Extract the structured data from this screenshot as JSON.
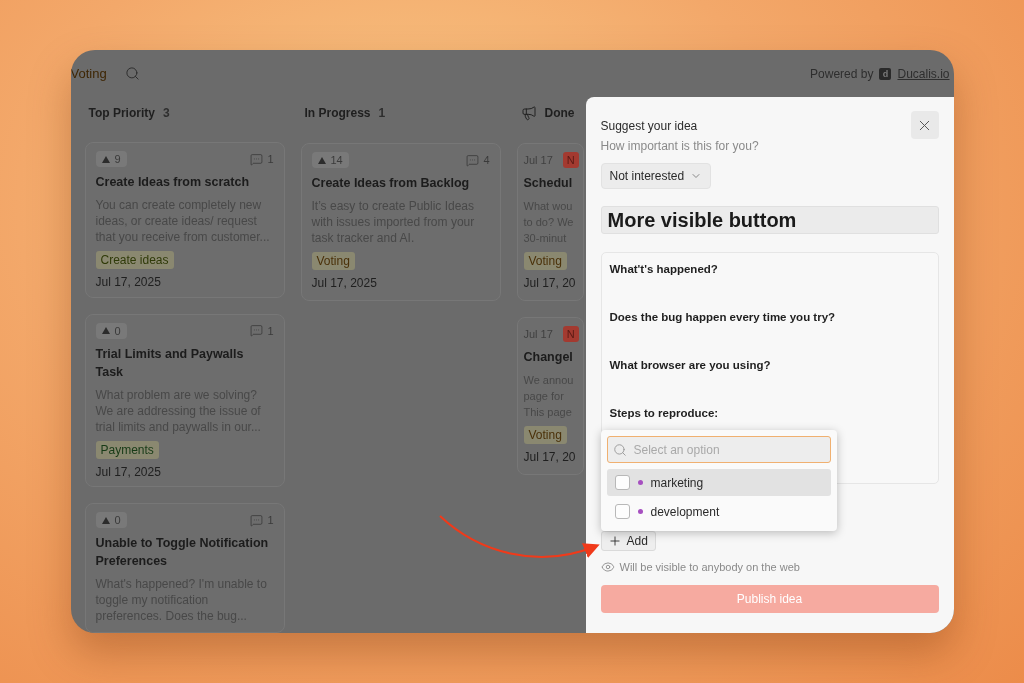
{
  "header": {
    "filter": "Voting",
    "powered_by": "Powered by",
    "logo_letter": "d",
    "brand_link": "Ducalis.io"
  },
  "columns": [
    {
      "title": "Top Priority",
      "count": "3",
      "cards": [
        {
          "kind": "voted",
          "votes": "9",
          "comments": "1",
          "title": "Create Ideas from scratch",
          "description": "You can create completely new ideas, or create ideas/ request that you receive from customer...",
          "tag": {
            "label": "Create ideas",
            "color": "#2f3a08"
          },
          "date": "Jul 17, 2025"
        },
        {
          "kind": "voted",
          "votes": "0",
          "comments": "1",
          "title": "Trial Limits and Paywalls Task",
          "description": "What problem are we solving? We are addressing the issue of trial limits and paywalls in our...",
          "tag": {
            "label": "Payments",
            "color": "#163a16"
          },
          "date": "Jul 17, 2025"
        },
        {
          "kind": "voted",
          "votes": "0",
          "comments": "1",
          "title": "Unable to Toggle Notification Preferences",
          "description": "What's happened? I'm unable to toggle my notification preferences. Does the bug..."
        }
      ]
    },
    {
      "title": "In Progress",
      "count": "1",
      "cards": [
        {
          "kind": "voted",
          "votes": "14",
          "comments": "4",
          "title": "Create Ideas from Backlog",
          "description": "It’s easy to create Public Ideas with issues imported from your task tracker and AI.",
          "tag": {
            "label": "Voting",
            "color": "#4a3008"
          },
          "date": "Jul 17, 2025"
        }
      ]
    },
    {
      "title": "Done",
      "cards": [
        {
          "kind": "dated",
          "short_date": "Jul 17",
          "badge": "N",
          "title": "Schedul",
          "lines": [
            "What wou",
            "to do? We",
            "30-minut"
          ],
          "tag": {
            "label": "Voting",
            "color": "#4a3008"
          },
          "date": "Jul 17, 20"
        },
        {
          "kind": "dated",
          "short_date": "Jul 17",
          "badge": "N",
          "title": "Changel",
          "lines": [
            "We annou",
            "page for",
            "This page"
          ],
          "tag": {
            "label": "Voting",
            "color": "#4a3008"
          },
          "date": "Jul 17, 20"
        }
      ]
    }
  ],
  "modal": {
    "heading": "Suggest your idea",
    "question": "How important is this for you?",
    "importance": "Not interested",
    "title_value": "More visible buttom",
    "body_lines": [
      "What't's happened?",
      "Does the bug happen every time you try?",
      "What browser are you using?",
      "Steps to reproduce:"
    ],
    "tag_picker": {
      "placeholder": "Select an option",
      "options": [
        {
          "label": "marketing",
          "color": "#a64fc0",
          "checked": false,
          "selected": true
        },
        {
          "label": "development",
          "color": "#a64fc0",
          "checked": false,
          "selected": false
        }
      ]
    },
    "add_button": "Add",
    "visibility_note": "Will be visible to anybody on the web",
    "publish_button": "Publish idea"
  }
}
